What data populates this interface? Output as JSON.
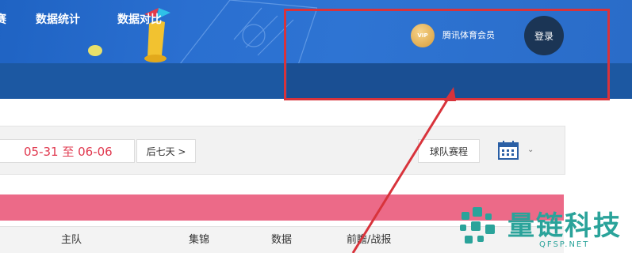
{
  "header": {
    "vip_badge": "VIP",
    "vip_label": "腾讯体育会员",
    "login_label": "登录"
  },
  "nav": {
    "items": [
      {
        "label": "赛"
      },
      {
        "label": "数据统计"
      },
      {
        "label": "数据对比"
      }
    ]
  },
  "filters": {
    "date_range": "05-31 至 06-06",
    "next_week": "后七天 >",
    "team_schedule": "球队赛程",
    "calendar_icon": "calendar-icon",
    "chevron_icon": "chevron-down-icon"
  },
  "table": {
    "columns": [
      "主队",
      "集锦",
      "数据",
      "前瞻/战报"
    ]
  },
  "watermark": {
    "name": "量链科技",
    "url": "QFSP.NET"
  },
  "colors": {
    "banner": "#2a6fd0",
    "nav": "#1c58a2",
    "annotation": "#d8333b",
    "pink_bar": "#ec6a88",
    "date_text": "#e0394f",
    "watermark": "#2aa39a"
  }
}
